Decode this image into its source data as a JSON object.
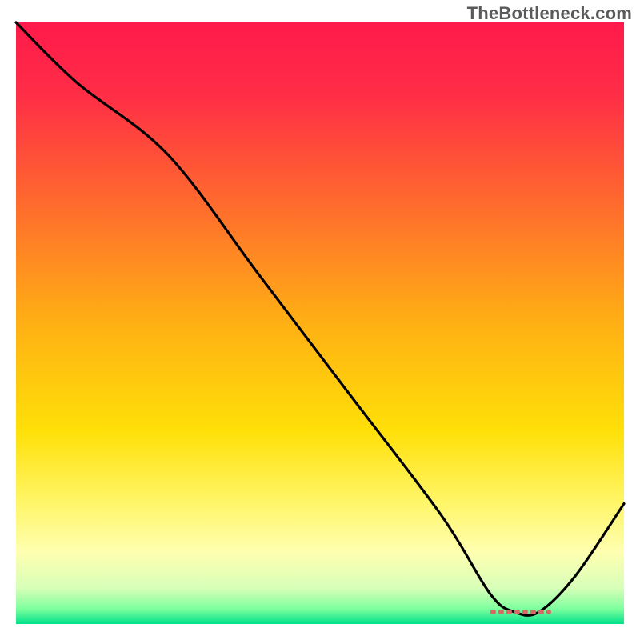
{
  "watermark": "TheBottleneck.com",
  "chart_data": {
    "type": "line",
    "title": "",
    "xlabel": "",
    "ylabel": "",
    "xlim": [
      0,
      100
    ],
    "ylim": [
      0,
      100
    ],
    "grid": false,
    "legend": false,
    "background_gradient_stops": [
      {
        "offset": 0.0,
        "color": "#ff1a4b"
      },
      {
        "offset": 0.12,
        "color": "#ff2d46"
      },
      {
        "offset": 0.3,
        "color": "#ff6a2e"
      },
      {
        "offset": 0.5,
        "color": "#ffb014"
      },
      {
        "offset": 0.68,
        "color": "#ffe008"
      },
      {
        "offset": 0.8,
        "color": "#fff66a"
      },
      {
        "offset": 0.88,
        "color": "#ffffb0"
      },
      {
        "offset": 0.94,
        "color": "#d8ffb8"
      },
      {
        "offset": 0.975,
        "color": "#7dff9e"
      },
      {
        "offset": 1.0,
        "color": "#00e18a"
      }
    ],
    "series": [
      {
        "name": "bottleneck-curve",
        "color": "#000000",
        "x": [
          0,
          10,
          25,
          40,
          55,
          70,
          78,
          82,
          86,
          92,
          100
        ],
        "values": [
          100,
          90,
          78,
          58,
          38,
          18,
          5,
          2,
          2,
          8,
          20
        ]
      }
    ],
    "markers": [
      {
        "name": "optimal-range-marker",
        "color": "#d86a66",
        "shape": "dashed-bar",
        "x_start": 78,
        "x_end": 88,
        "y": 2
      }
    ]
  }
}
